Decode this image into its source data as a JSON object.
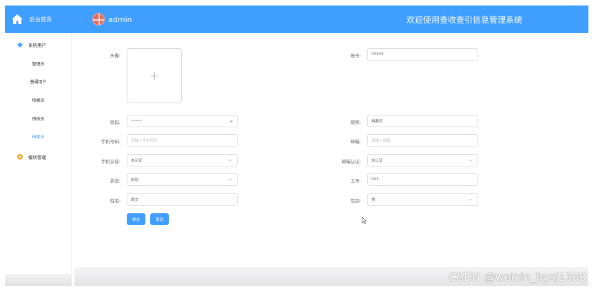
{
  "header": {
    "home_label": "后台首页",
    "username": "admin",
    "site_title": "欢迎使用查收查引信息管理系统",
    "bar_color": "#409eff"
  },
  "sidebar": {
    "group1": {
      "label": "系统用户",
      "icon": "star-icon"
    },
    "items": [
      {
        "label": "管理员",
        "active": false
      },
      {
        "label": "普通用户",
        "active": false
      },
      {
        "label": "检索员",
        "active": false
      },
      {
        "label": "审核员",
        "active": false
      },
      {
        "label": "档案员",
        "active": true
      }
    ],
    "group2": {
      "label": "模块管理",
      "icon": "gear-icon"
    }
  },
  "form": {
    "avatar_label": "头像:",
    "account_label": "账号:",
    "account_value": "44444",
    "password_label": "密码:",
    "password_value": "•••••",
    "nickname_label": "昵称:",
    "nickname_value": "档案员",
    "phone_label": "手机号码:",
    "phone_placeholder": "请输入手机号码",
    "email_label": "邮箱:",
    "email_placeholder": "请输入邮箱",
    "phone_auth_label": "手机认证:",
    "phone_auth_value": "未认证",
    "email_auth_label": "邮箱认证:",
    "email_auth_value": "未认证",
    "status_label": "状态:",
    "status_value": "启用",
    "job_no_label": "工号:",
    "job_no_value": "003",
    "name_label": "姓名:",
    "name_value": "周文",
    "gender_label": "性别:",
    "gender_value": "男",
    "submit_label": "提交",
    "cancel_label": "取消"
  },
  "watermark": "CSDN @weixin_bysj1330"
}
